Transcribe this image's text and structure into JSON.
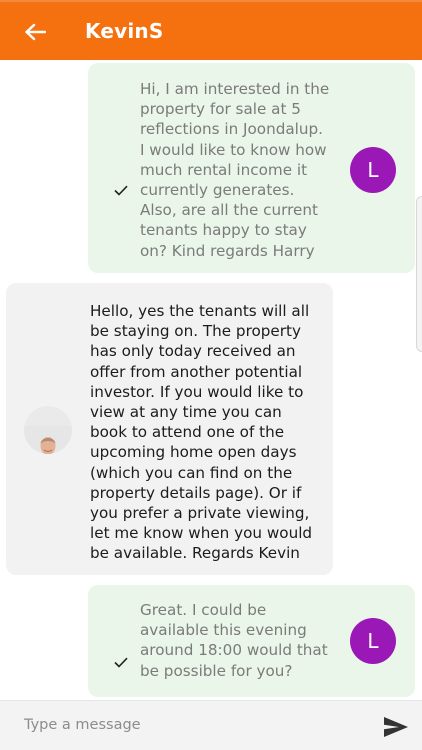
{
  "header": {
    "title": "KevinS",
    "back_icon": "arrow-left-icon",
    "background_color": "#f5700f"
  },
  "messages": [
    {
      "direction": "outgoing",
      "text": "Hi, I am interested in the\nproperty for sale at 5\nreflections in Joondalup.\nI would like to know how\nmuch rental income it\ncurrently generates.\nAlso, are all the current\ntenants happy to stay\non? Kind regards Harry",
      "status_icon": "check-icon",
      "avatar_initial": "L",
      "avatar_color": "#9a19b6"
    },
    {
      "direction": "incoming",
      "text": "Hello, yes the tenants will all\nbe staying on. The property\nhas only today received an\noffer from another potential\ninvestor. If you would like to\nview at any time you can\nbook to attend one of the\nupcoming home open days\n(which you can find on the\nproperty details page). Or if\nyou prefer a private viewing,\nlet me know when you would\nbe available. Regards Kevin",
      "avatar_type": "photo"
    },
    {
      "direction": "outgoing",
      "text": "Great. I could be\navailable this evening\naround 18:00 would that\nbe possible for you?",
      "status_icon": "check-icon",
      "avatar_initial": "L",
      "avatar_color": "#9a19b6"
    }
  ],
  "composer": {
    "placeholder": "Type a message",
    "value": "",
    "send_icon": "send-icon"
  },
  "colors": {
    "outgoing_bubble": "#e9f6e9",
    "incoming_bubble": "#f2f2f2",
    "outgoing_text": "#7b7b7b",
    "incoming_text": "#1c1c1c"
  }
}
